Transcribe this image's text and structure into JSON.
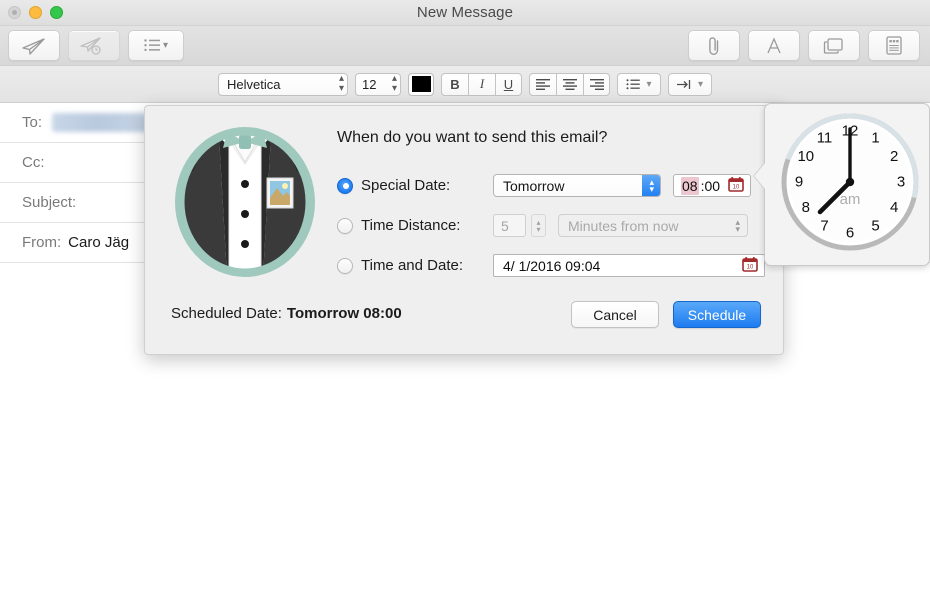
{
  "window": {
    "title": "New Message",
    "traffic": {
      "close": "close-button",
      "minimize": "minimize-button",
      "zoom": "zoom-button"
    }
  },
  "toolbar": {
    "left": [
      {
        "name": "send-button",
        "icon": "paper-plane-icon",
        "enabled": true
      },
      {
        "name": "send-later-button",
        "icon": "paper-plane-clock-icon",
        "enabled": false
      },
      {
        "name": "header-fields-button",
        "icon": "list-icon",
        "enabled": true
      }
    ],
    "right": [
      {
        "name": "attach-button",
        "icon": "paperclip-icon"
      },
      {
        "name": "format-button",
        "icon": "letter-a-icon"
      },
      {
        "name": "photo-browser-button",
        "icon": "photos-icon"
      },
      {
        "name": "stationery-button",
        "icon": "stationery-icon"
      }
    ]
  },
  "format_bar": {
    "font_family": "Helvetica",
    "font_size": "12",
    "color_swatch": "#000000",
    "bold": "B",
    "italic": "I",
    "underline": "U",
    "align_left": "align-left",
    "align_center": "align-center",
    "align_right": "align-right",
    "lists": "list",
    "indent": "indent"
  },
  "compose": {
    "fields": [
      {
        "label": "To:",
        "value": "",
        "redacted": true
      },
      {
        "label": "Cc:",
        "value": "",
        "redacted": false
      },
      {
        "label": "Subject:",
        "value": "",
        "redacted": false
      },
      {
        "label": "From:",
        "value": "Caro Jäg",
        "redacted": false
      }
    ]
  },
  "dialog": {
    "title": "When do you want to send this email?",
    "app_icon": "tuxedo-icon",
    "options": [
      {
        "id": "special-date",
        "label": "Special Date:",
        "selected": true,
        "select_value": "Tomorrow",
        "time_value_highlighted": "08",
        "time_value_rest": ":00",
        "calendar_icon_day": "10"
      },
      {
        "id": "time-distance",
        "label": "Time Distance:",
        "selected": false,
        "amount": "5",
        "unit": "Minutes from now"
      },
      {
        "id": "time-and-date",
        "label": "Time and Date:",
        "selected": false,
        "datetime": "4/  1/2016 09:04",
        "calendar_icon_day": "10"
      }
    ],
    "scheduled_label": "Scheduled Date:",
    "scheduled_value": "Tomorrow 08:00",
    "cancel_label": "Cancel",
    "confirm_label": "Schedule"
  },
  "clock_popover": {
    "name": "time-picker-clock",
    "meridiem": "am",
    "hour": 8,
    "minute": 0,
    "numerals": [
      "12",
      "1",
      "2",
      "3",
      "4",
      "5",
      "6",
      "7",
      "8",
      "9",
      "10",
      "11"
    ]
  },
  "colors": {
    "accent_blue": "#1d7cf0",
    "selection_pink": "#edc7cf",
    "calendar_red": "#a32a2a",
    "tux_ring": "#9fc9bd"
  }
}
